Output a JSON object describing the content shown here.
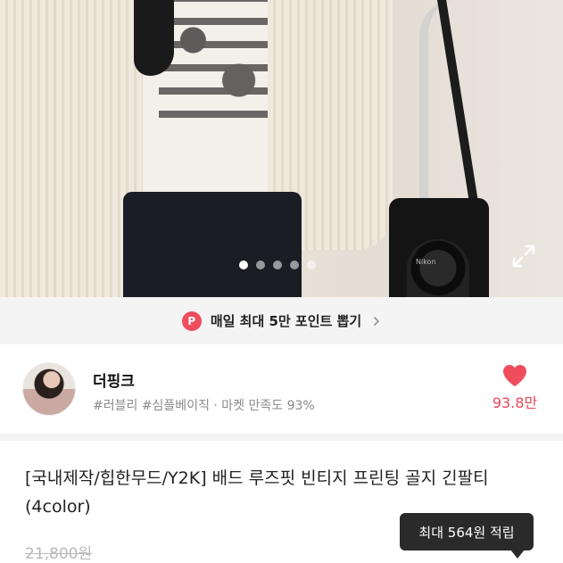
{
  "photo": {
    "camera_brand": "Nikon",
    "carousel": {
      "total": 5,
      "active_index": 0
    },
    "expand_icon": "expand-icon"
  },
  "points_banner": {
    "badge": "P",
    "text": "매일 최대 5만 포인트 뽑기",
    "chevron_icon": "chevron-right-icon"
  },
  "shop": {
    "name": "더핑크",
    "tags": "#러블리 #심플베이직 · 마켓 만족도 93%",
    "like_icon": "heart-icon",
    "like_count": "93.8만",
    "accent_color": "#ef4d5e"
  },
  "product": {
    "title": "[국내제작/힙한무드/Y2K] 배드 루즈핏 빈티지 프린팅 골지 긴팔티 (4color)",
    "original_price": "21,800원"
  },
  "tooltip": {
    "text": "최대 564원 적립"
  }
}
